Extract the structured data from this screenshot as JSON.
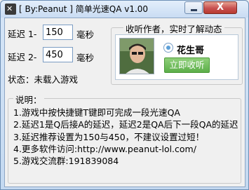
{
  "window": {
    "title": "[ By:Peanut ] 简单光速QA v1.00",
    "close_label": "X"
  },
  "delay1": {
    "label": "延迟 1-",
    "value": "150",
    "unit": "毫秒"
  },
  "delay2": {
    "label": "延迟 2-",
    "value": "450",
    "unit": "毫秒"
  },
  "status": {
    "text": "状态：未载入游戏"
  },
  "author_group": {
    "title": "收听作者，实时了解动态",
    "name": "花生哥",
    "listen_label": "立即收听"
  },
  "notes": {
    "title": "说明：",
    "lines": [
      "1.游戏中按快捷键T键即可完成一段光速QA",
      "2.延迟1是Q后接A的延迟，延迟2是QA后下一段QA的延迟",
      "3.延迟推荐设置为150与450，不建议设置过短！",
      "4.更多软件访问:http://www.peanut-lol.com/",
      "5.游戏交流群:191839084"
    ]
  }
}
